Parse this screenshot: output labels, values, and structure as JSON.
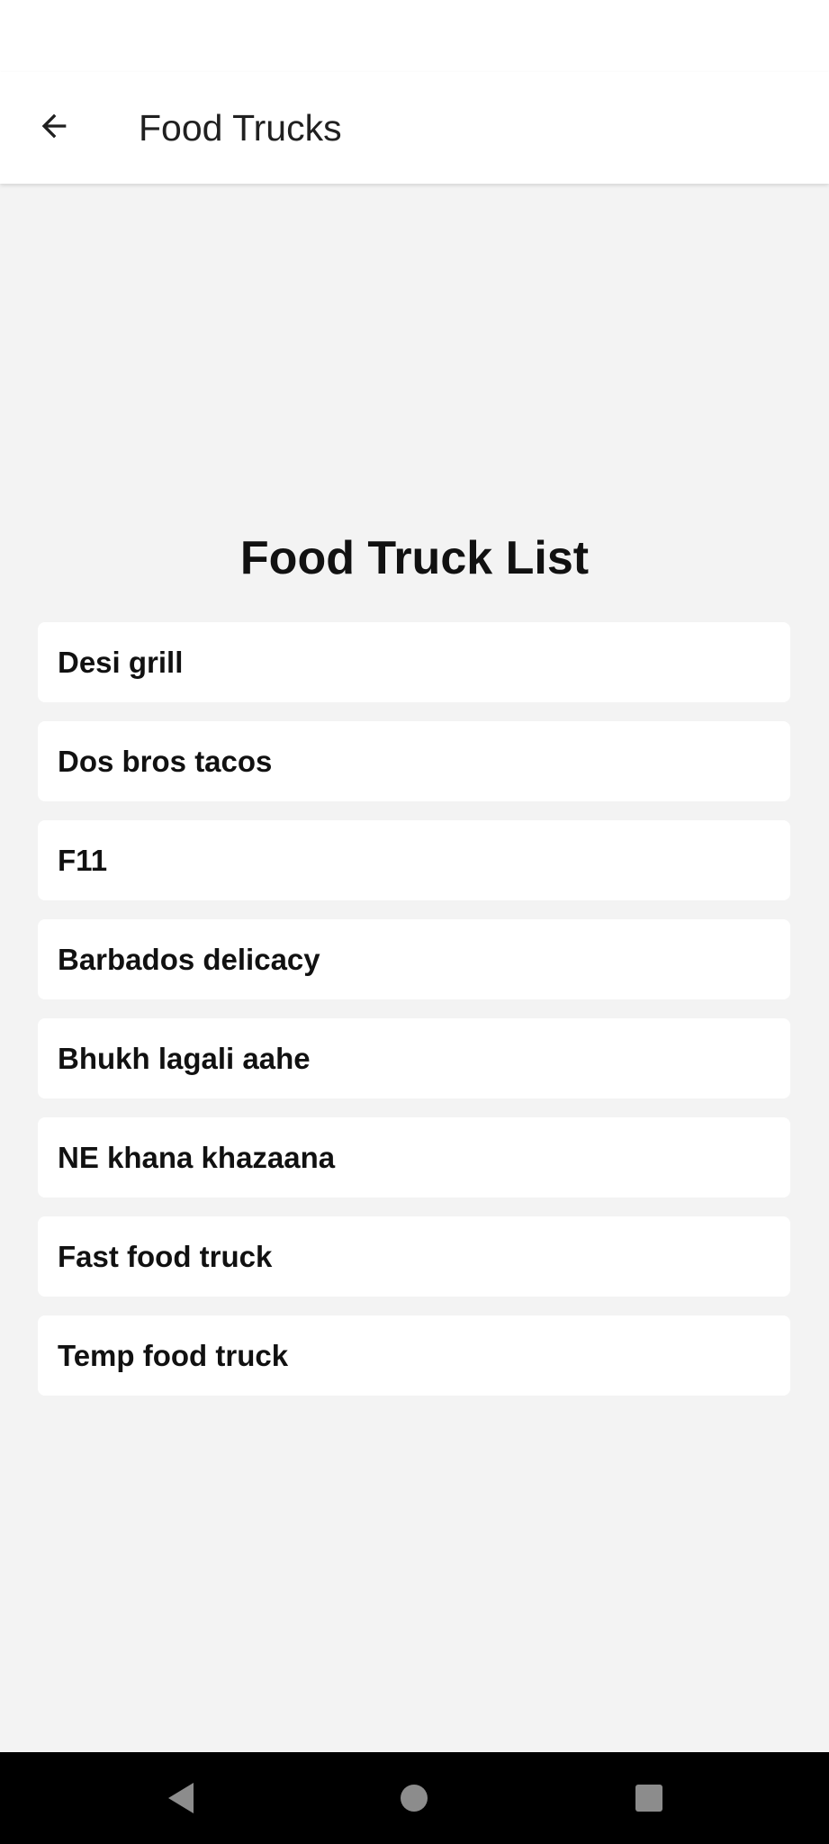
{
  "app_bar": {
    "title": "Food Trucks",
    "back_icon": "arrow-left-icon"
  },
  "main": {
    "heading": "Food Truck List",
    "trucks": [
      "Desi grill",
      "Dos bros tacos",
      "F11",
      "Barbados delicacy",
      "Bhukh lagali aahe",
      "NE khana khazaana",
      "Fast food truck",
      "Temp food truck"
    ]
  },
  "nav_bar": {
    "back_icon": "triangle-back-icon",
    "home_icon": "circle-home-icon",
    "recents_icon": "square-recents-icon"
  },
  "colors": {
    "background": "#f3f3f3",
    "surface": "#ffffff",
    "text": "#111111",
    "nav_bar": "#000000"
  }
}
